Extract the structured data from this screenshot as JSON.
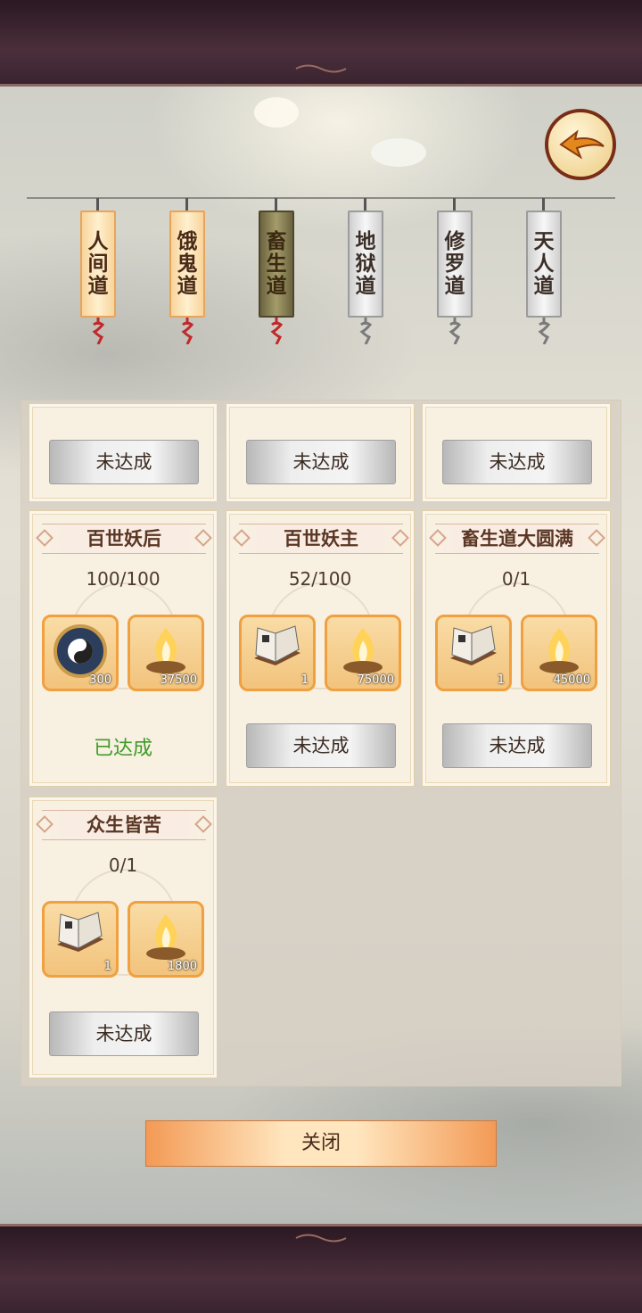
{
  "tabs": [
    {
      "label": "人间道",
      "state": "gold"
    },
    {
      "label": "饿鬼道",
      "state": "gold"
    },
    {
      "label": "畜生道",
      "state": "active"
    },
    {
      "label": "地狱道",
      "state": "grey"
    },
    {
      "label": "修罗道",
      "state": "grey"
    },
    {
      "label": "天人道",
      "state": "grey"
    }
  ],
  "top_row": [
    {
      "status": "未达成"
    },
    {
      "status": "未达成"
    },
    {
      "status": "未达成"
    }
  ],
  "cards": [
    {
      "title": "百世妖后",
      "progress": "100/100",
      "rewards": [
        {
          "icon": "yin-yang-compass-icon",
          "count": "300"
        },
        {
          "icon": "flame-bowl-icon",
          "count": "37500"
        }
      ],
      "status": "已达成"
    },
    {
      "title": "百世妖主",
      "progress": "52/100",
      "rewards": [
        {
          "icon": "book-icon",
          "count": "1"
        },
        {
          "icon": "flame-bowl-icon",
          "count": "75000"
        }
      ],
      "status": "未达成"
    },
    {
      "title": "畜生道大圆满",
      "progress": "0/1",
      "rewards": [
        {
          "icon": "book-icon",
          "count": "1"
        },
        {
          "icon": "flame-bowl-icon",
          "count": "45000"
        }
      ],
      "status": "未达成"
    },
    {
      "title": "众生皆苦",
      "progress": "0/1",
      "rewards": [
        {
          "icon": "book-icon",
          "count": "1"
        },
        {
          "icon": "flame-bowl-icon",
          "count": "1800"
        }
      ],
      "status": "未达成"
    }
  ],
  "close_label": "关闭",
  "back_icon": "back-arrow-icon"
}
